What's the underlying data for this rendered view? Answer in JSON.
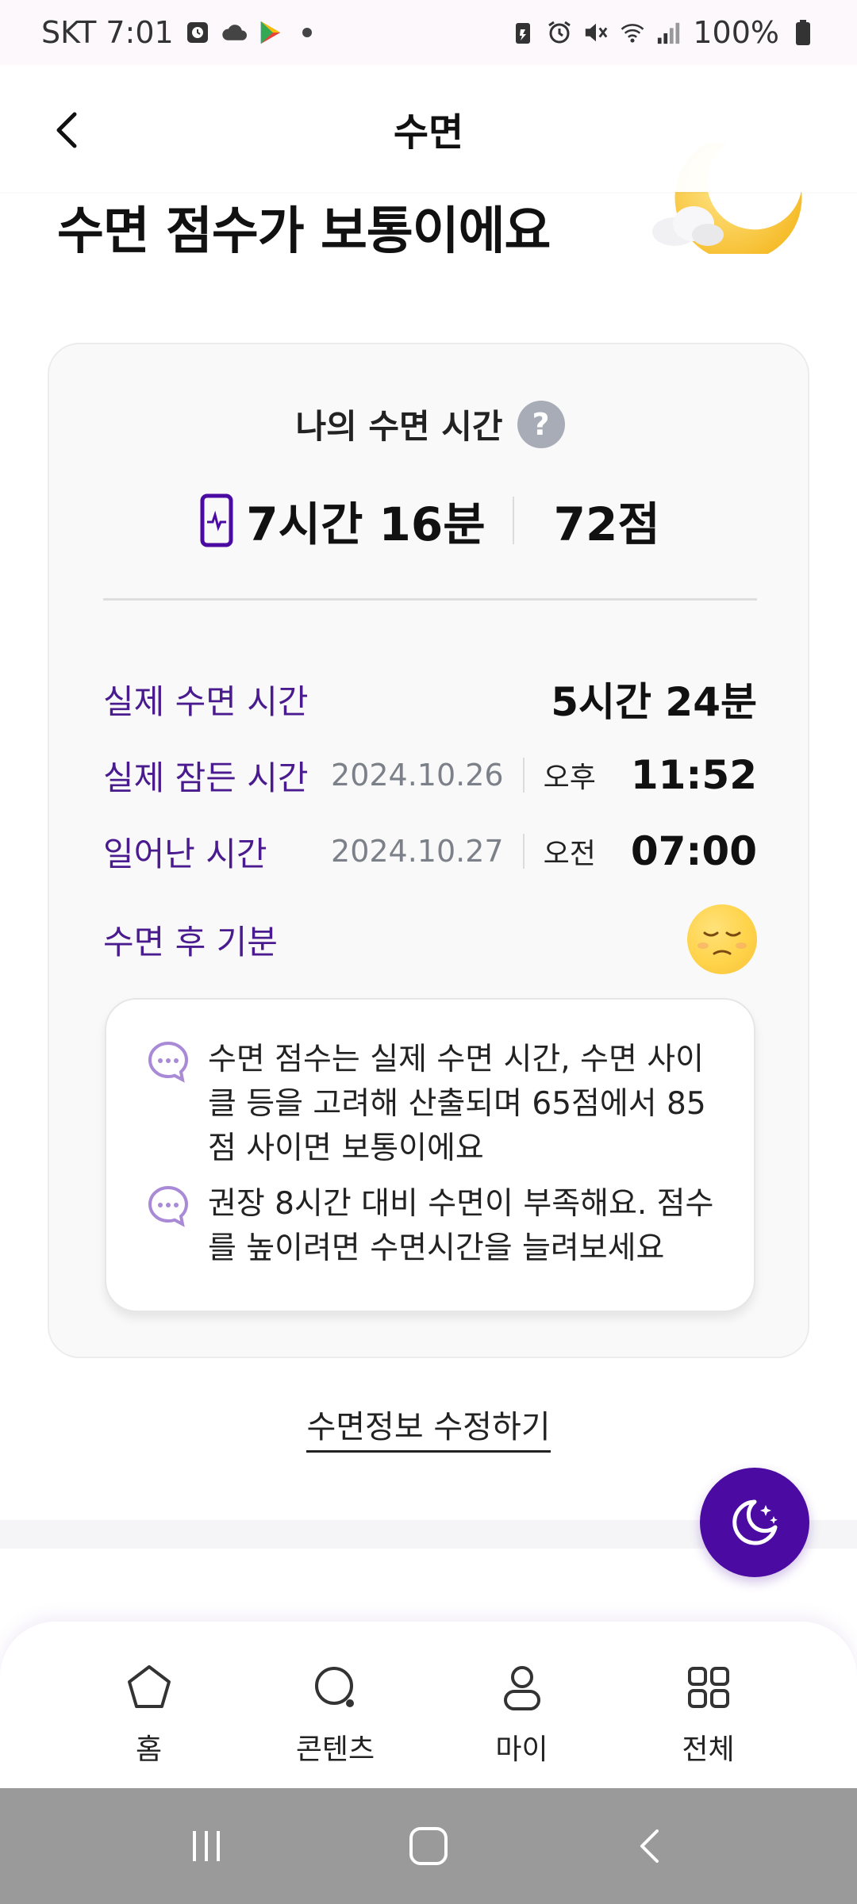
{
  "status_bar": {
    "carrier_time": "SKT 7:01",
    "battery": "100%"
  },
  "header": {
    "title": "수면"
  },
  "heading": {
    "text": "수면 점수가 보통이에요"
  },
  "card": {
    "title": "나의 수면 시간",
    "help_symbol": "?",
    "total_time": "7시간 16분",
    "score": "72점",
    "rows": [
      {
        "label": "실제 수면 시간",
        "value": "5시간 24분"
      },
      {
        "label": "실제 잠든 시간",
        "date": "2024.10.26",
        "ampm": "오후",
        "time": "11:52"
      },
      {
        "label": "일어난 시간",
        "date": "2024.10.27",
        "ampm": "오전",
        "time": "07:00"
      },
      {
        "label": "수면 후 기분"
      }
    ],
    "info": [
      "수면 점수는 실제 수면 시간, 수면 사이클 등을 고려해 산출되며 65점에서 85점 사이면 보통이에요",
      "권장 8시간 대비 수면이 부족해요. 점수를 높이려면 수면시간을 늘려보세요"
    ]
  },
  "edit_link": "수면정보 수정하기",
  "bottom_nav": [
    {
      "label": "홈",
      "icon": "home-icon"
    },
    {
      "label": "콘텐츠",
      "icon": "content-search-icon"
    },
    {
      "label": "마이",
      "icon": "person-icon"
    },
    {
      "label": "전체",
      "icon": "grid-icon"
    }
  ],
  "colors": {
    "accent": "#4b0ba3",
    "label_purple": "#4a1a8f",
    "card_bg": "#f9f9f9",
    "mood_yellow": "#ffd34a"
  }
}
